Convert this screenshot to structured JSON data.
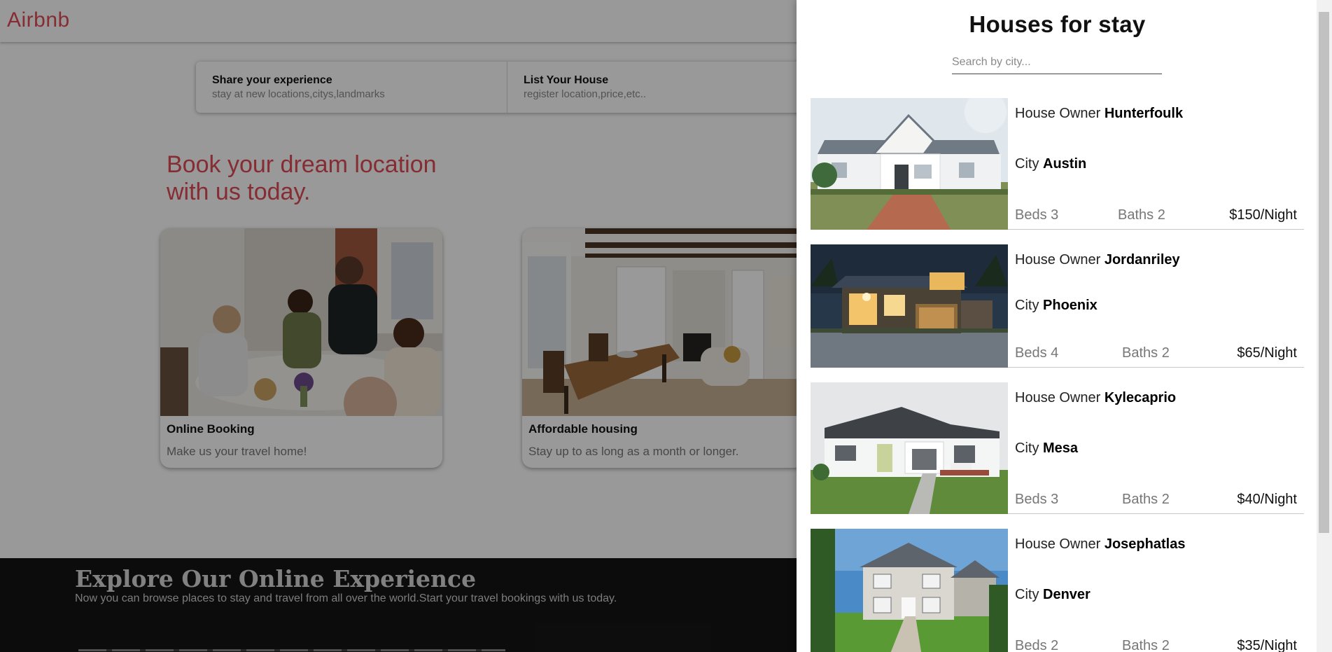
{
  "nav": {
    "logo": "Airbnb"
  },
  "pill": {
    "share": {
      "title": "Share your experience",
      "subtitle": "stay at new locations,citys,landmarks"
    },
    "list": {
      "title": "List Your House",
      "subtitle": "register location,price,etc.."
    }
  },
  "hero": {
    "line1": "Book your dream location",
    "line2": "with us today."
  },
  "cards": [
    {
      "title": "Online Booking",
      "subtitle": "Make us your travel home!"
    },
    {
      "title": "Affordable housing",
      "subtitle": "Stay up to as long as a month or longer."
    }
  ],
  "footer": {
    "title": "Explore Our Online Experience",
    "subtitle": "Now you can browse places to stay and travel from all over the world.Start your travel bookings with us today."
  },
  "drawer": {
    "title": "Houses for stay",
    "search_placeholder": "Search by city...",
    "owner_label": "House Owner",
    "city_label": "City",
    "beds_label": "Beds",
    "baths_label": "Baths",
    "houses": [
      {
        "owner": "Hunterfoulk",
        "city": "Austin",
        "beds": "3",
        "baths": "2",
        "price": "$150/Night"
      },
      {
        "owner": "Jordanriley",
        "city": "Phoenix",
        "beds": "4",
        "baths": "2",
        "price": "$65/Night"
      },
      {
        "owner": "Kylecaprio",
        "city": "Mesa",
        "beds": "3",
        "baths": "2",
        "price": "$40/Night"
      },
      {
        "owner": "Josephatlas",
        "city": "Denver",
        "beds": "2",
        "baths": "2",
        "price": "$35/Night"
      }
    ]
  },
  "colors": {
    "brand": "#e04a55",
    "footer_bg": "#151515"
  }
}
